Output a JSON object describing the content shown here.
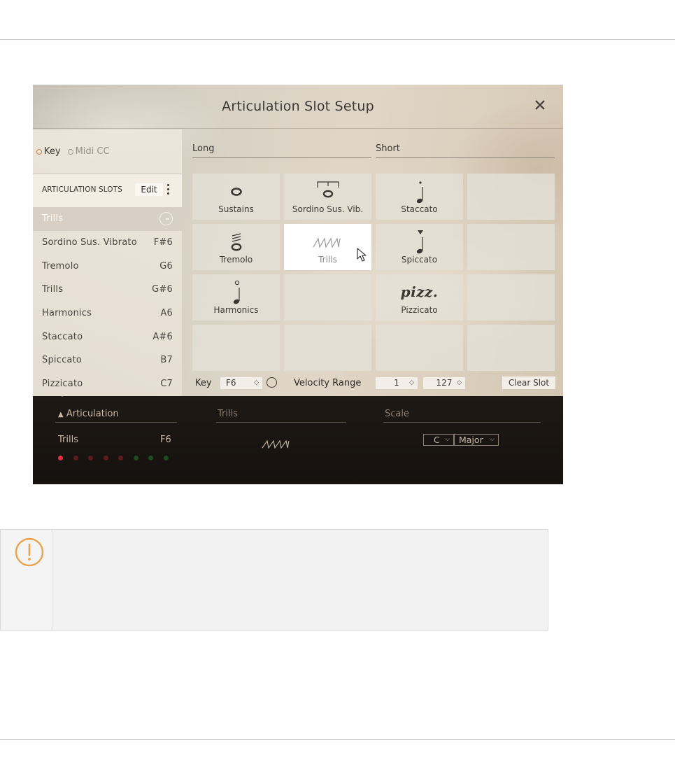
{
  "dialog": {
    "title": "Articulation Slot Setup",
    "close_icon": "close-icon"
  },
  "mode": {
    "key_label": "Key",
    "midi_cc_label": "Midi CC",
    "selected": "Key"
  },
  "slots_panel": {
    "heading": "ARTICULATION SLOTS",
    "edit_label": "Edit",
    "selected_slot": "Trills",
    "slots": [
      {
        "name": "Sordino Sus. Vibrato",
        "key": "F#6"
      },
      {
        "name": "Tremolo",
        "key": "G6"
      },
      {
        "name": "Trills",
        "key": "G#6"
      },
      {
        "name": "Harmonics",
        "key": "A6"
      },
      {
        "name": "Staccato",
        "key": "A#6"
      },
      {
        "name": "Spiccato",
        "key": "B7"
      },
      {
        "name": "Pizzicato",
        "key": "C7"
      }
    ]
  },
  "categories": {
    "long": "Long",
    "short": "Short"
  },
  "grid": {
    "cells": [
      {
        "label": "Sustains",
        "icon": "whole-note-icon"
      },
      {
        "label": "Sordino Sus. Vib.",
        "icon": "sordino-note-icon"
      },
      {
        "label": "Staccato",
        "icon": "staccato-note-icon"
      },
      {
        "label": "",
        "icon": ""
      },
      {
        "label": "Tremolo",
        "icon": "tremolo-note-icon"
      },
      {
        "label": "Trills",
        "icon": "trill-wave-icon",
        "selected": true
      },
      {
        "label": "Spiccato",
        "icon": "spiccato-note-icon"
      },
      {
        "label": "",
        "icon": ""
      },
      {
        "label": "Harmonics",
        "icon": "harmonic-note-icon"
      },
      {
        "label": "",
        "icon": ""
      },
      {
        "label": "Pizzicato",
        "glyph": "pizz.",
        "icon": "pizz-text-icon"
      },
      {
        "label": "",
        "icon": ""
      }
    ]
  },
  "controls": {
    "key_label": "Key",
    "key_value": "F6",
    "velocity_label": "Velocity Range",
    "velocity_min": "1",
    "velocity_max": "127",
    "clear_label": "Clear Slot"
  },
  "footer": {
    "articulation_header": "Articulation",
    "current_articulation": "Trills",
    "current_key": "F6",
    "middle_header": "Trills",
    "scale_header": "Scale",
    "scale_root": "C",
    "scale_mode": "Major",
    "dot_colors": [
      "#e0303f",
      "#5a1a20",
      "#5a1a20",
      "#5a1a20",
      "#5a1a20",
      "#1f4a22",
      "#1f4a22",
      "#1f4a22"
    ]
  },
  "colors": {
    "accent": "#c9864a",
    "dark_bg": "#1a1512"
  }
}
